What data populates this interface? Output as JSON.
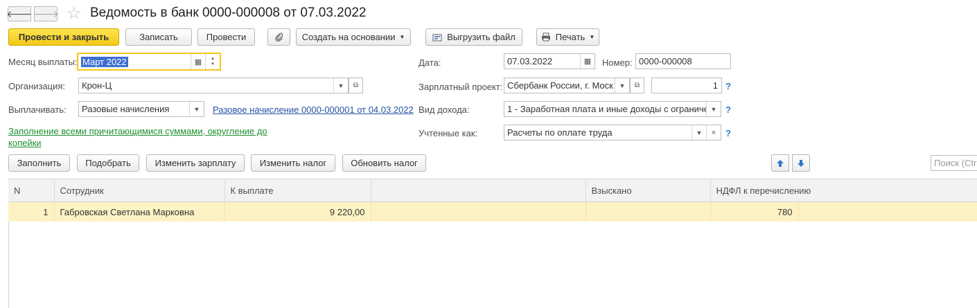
{
  "header": {
    "back_glyph": "🡐",
    "forward_glyph": "🡒",
    "star_glyph": "☆",
    "title": "Ведомость в банк 0000-000008 от 07.03.2022"
  },
  "toolbar": {
    "post_close": "Провести и закрыть",
    "save": "Записать",
    "post": "Провести",
    "create_based": "Создать на основании",
    "export_file": "Выгрузить файл",
    "print": "Печать"
  },
  "form": {
    "month_label": "Месяц выплаты:",
    "month_value": "Март 2022",
    "org_label": "Организация:",
    "org_value": "Крон-Ц",
    "pay_label": "Выплачивать:",
    "pay_value": "Разовые начисления",
    "pay_link": "Разовое начисление 0000-000001 от 04.03.2022",
    "fill_all_link": "Заполнение всеми причитающимися суммами, округление до копейки",
    "date_label": "Дата:",
    "date_value": "07.03.2022",
    "number_label": "Номер:",
    "number_value": "0000-000008",
    "salary_project_label": "Зарплатный проект:",
    "salary_project_value": "Сбербанк России, г. Моск",
    "salary_project_num": "1",
    "income_type_label": "Вид дохода:",
    "income_type_value": "1 - Заработная плата и иные доходы с ограниче",
    "counted_as_label": "Учтенные как:",
    "counted_as_value": "Расчеты по оплате труда",
    "help_glyph": "?"
  },
  "table_toolbar": {
    "fill": "Заполнить",
    "pick": "Подобрать",
    "change_salary": "Изменить зарплату",
    "change_tax": "Изменить налог",
    "update_tax": "Обновить налог",
    "search_placeholder": "Поиск (Ctrl+F)"
  },
  "table": {
    "columns": [
      "N",
      "Сотрудник",
      "К выплате",
      "",
      "Взыскано",
      "НДФЛ к перечислению",
      ""
    ],
    "rows": [
      {
        "n": "1",
        "employee": "Габровская Светлана Марковна",
        "to_pay": "9 220,00",
        "extra": "",
        "withheld": "",
        "ndfl": "780",
        "tail": ""
      }
    ]
  },
  "colors": {
    "primary_button": "#f5d026",
    "selected_row": "#fdf2c4",
    "link_blue": "#2752a6",
    "link_green": "#1d8f2e",
    "help_blue": "#2b7bc0"
  }
}
